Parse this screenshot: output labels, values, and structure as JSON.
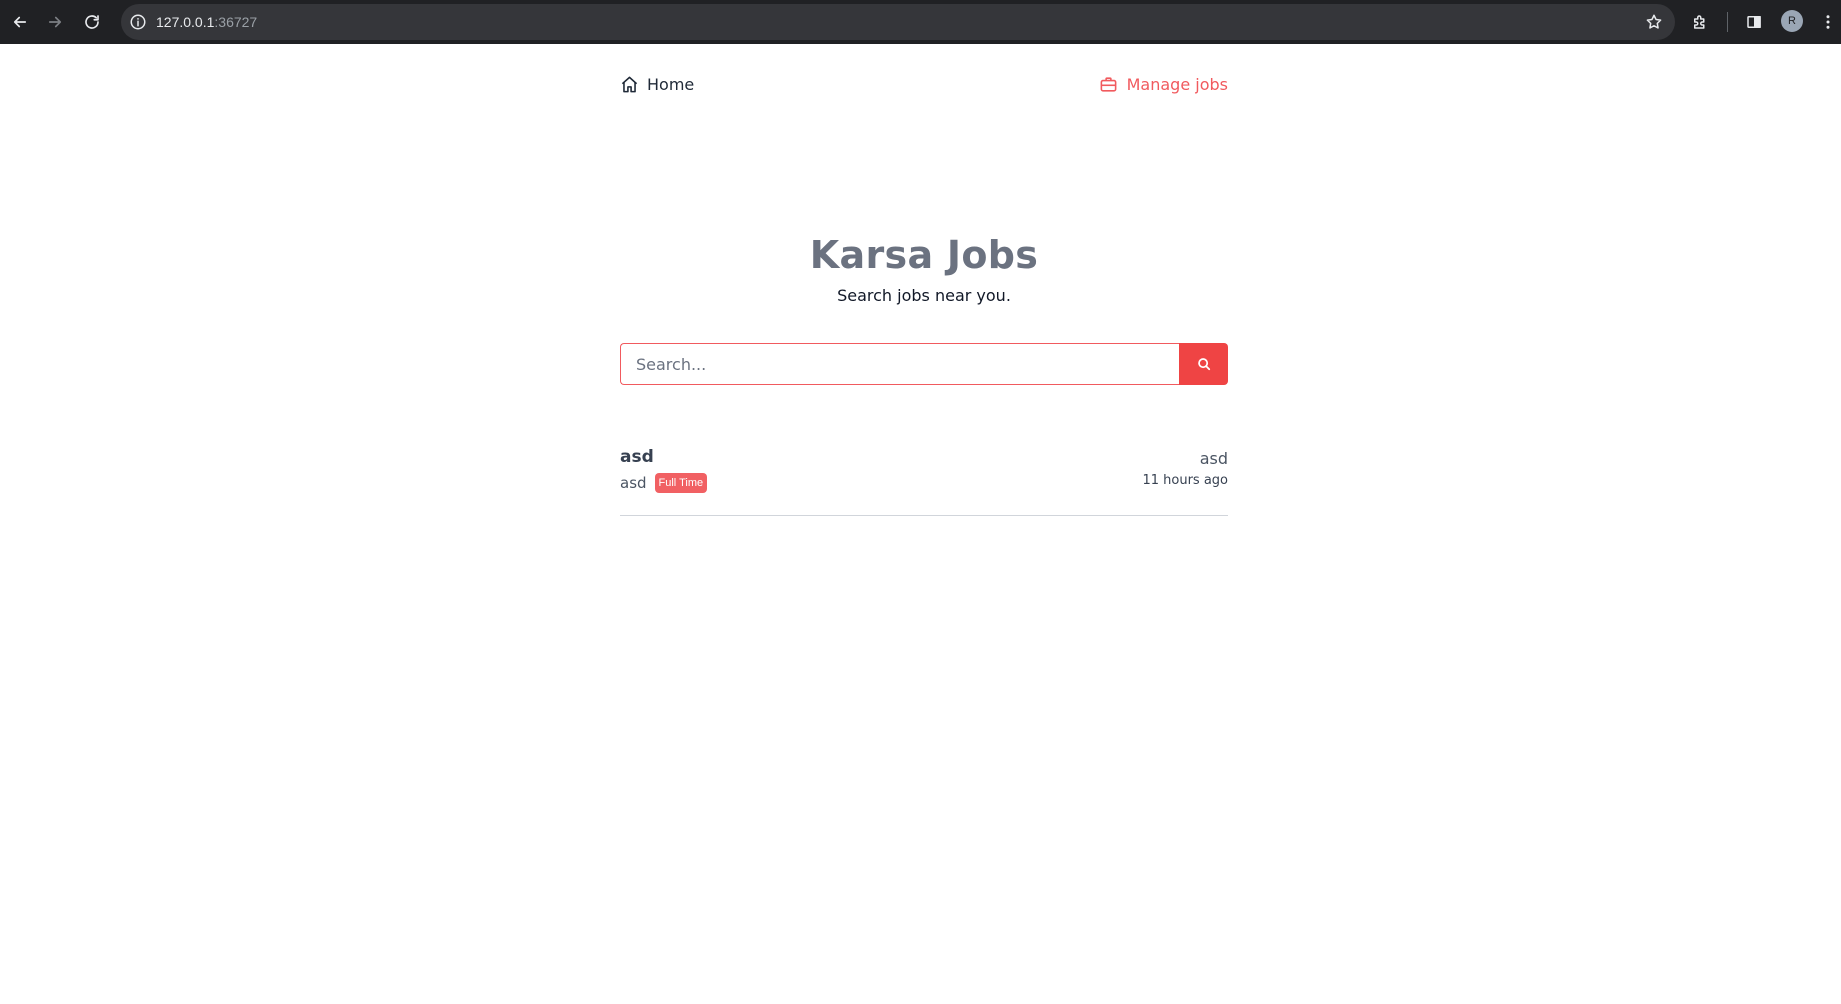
{
  "browser": {
    "url_host": "127.0.0.1",
    "url_port": ":36727",
    "profile_initial": "R"
  },
  "nav": {
    "home_label": "Home",
    "manage_label": "Manage jobs"
  },
  "hero": {
    "title": "Karsa Jobs",
    "subtitle": "Search jobs near you."
  },
  "search": {
    "placeholder": "Search...",
    "value": ""
  },
  "jobs": [
    {
      "title": "asd",
      "company": "asd",
      "type": "Full Time",
      "location": "asd",
      "posted": "11 hours ago"
    }
  ],
  "colors": {
    "accent": "#ef4444",
    "link_accent": "#f15a5e",
    "title_gray": "#6b7280",
    "chrome_bg": "#202124"
  },
  "icons": [
    "back-icon",
    "forward-icon",
    "reload-icon",
    "info-icon",
    "star-icon",
    "extensions-icon",
    "side-panel-icon",
    "menu-icon",
    "home-icon",
    "briefcase-icon",
    "search-icon"
  ]
}
